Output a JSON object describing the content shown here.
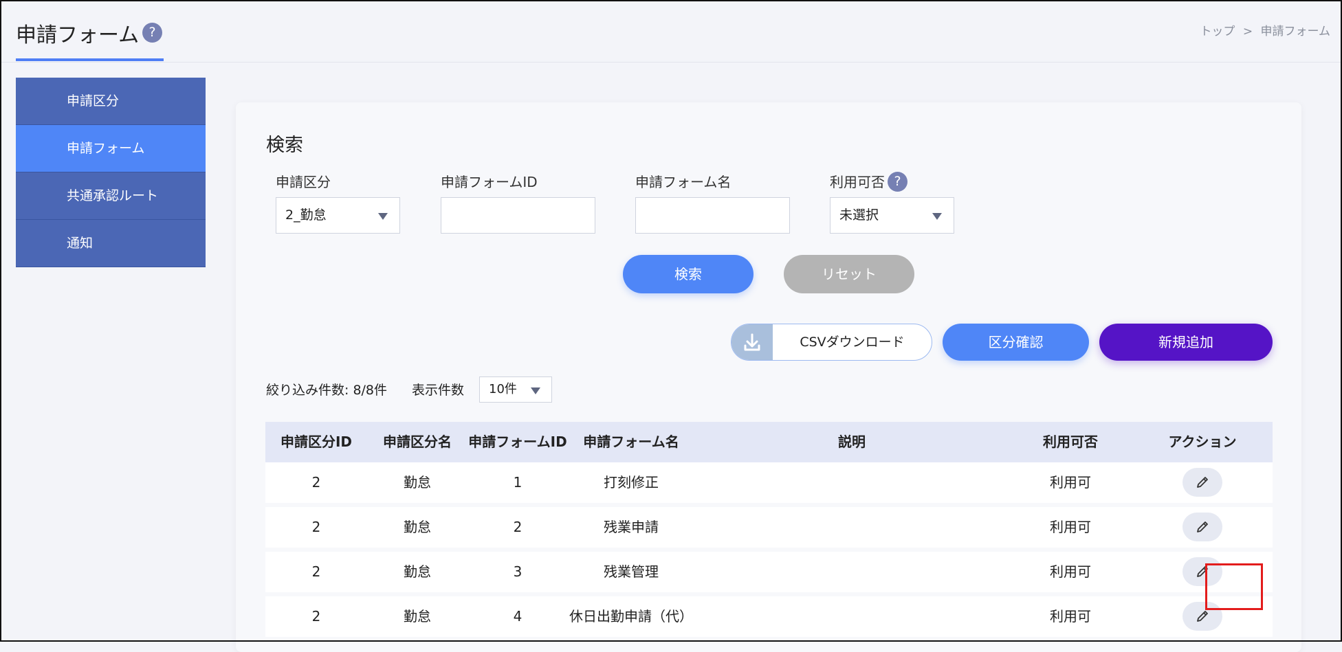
{
  "header": {
    "title": "申請フォーム",
    "help_glyph": "?",
    "breadcrumb": {
      "home": "トップ",
      "separator": ">",
      "current": "申請フォーム"
    }
  },
  "sidebar": {
    "items": [
      {
        "label": "申請区分",
        "active": false
      },
      {
        "label": "申請フォーム",
        "active": true
      },
      {
        "label": "共通承認ルート",
        "active": false
      },
      {
        "label": "通知",
        "active": false
      }
    ]
  },
  "search": {
    "title": "検索",
    "category_label": "申請区分",
    "category_value": "2_勤怠",
    "form_id_label": "申請フォームID",
    "form_id_value": "",
    "form_name_label": "申請フォーム名",
    "form_name_value": "",
    "availability_label": "利用可否",
    "availability_value": "未選択",
    "search_button": "検索",
    "reset_button": "リセット"
  },
  "actions": {
    "csv_download": "CSVダウンロード",
    "category_confirm": "区分確認",
    "new_add": "新規追加"
  },
  "list": {
    "count_text": "絞り込み件数: 8/8件",
    "perpage_label": "表示件数",
    "perpage_value": "10件"
  },
  "table": {
    "headers": [
      "申請区分ID",
      "申請区分名",
      "申請フォームID",
      "申請フォーム名",
      "説明",
      "利用可否",
      "アクション"
    ],
    "rows": [
      {
        "category_id": "2",
        "category_name": "勤怠",
        "form_id": "1",
        "form_name": "打刻修正",
        "description": "",
        "availability": "利用可"
      },
      {
        "category_id": "2",
        "category_name": "勤怠",
        "form_id": "2",
        "form_name": "残業申請",
        "description": "",
        "availability": "利用可"
      },
      {
        "category_id": "2",
        "category_name": "勤怠",
        "form_id": "3",
        "form_name": "残業管理",
        "description": "",
        "availability": "利用可"
      },
      {
        "category_id": "2",
        "category_name": "勤怠",
        "form_id": "4",
        "form_name": "休日出勤申請（代）",
        "description": "",
        "availability": "利用可"
      }
    ]
  },
  "colors": {
    "primary": "#4f86f7",
    "sidebar": "#4b67b5",
    "add_button": "#5514c6",
    "reset_button": "#b4b4b4",
    "highlight": "#e31c1c"
  },
  "icons": {
    "help": "help-circle-icon",
    "download": "download-icon",
    "edit": "pencil-icon",
    "dropdown": "caret-down-icon"
  }
}
